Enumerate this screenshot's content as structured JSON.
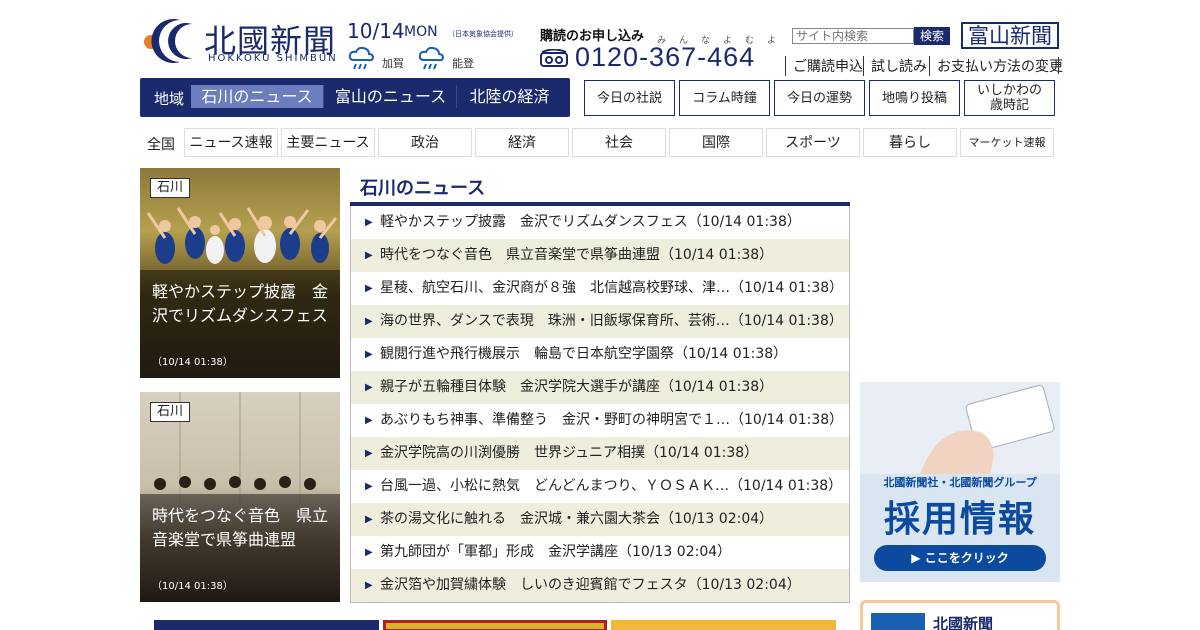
{
  "header": {
    "logo_jp": "北國新聞",
    "logo_en": "HOKKOKU SHIMBUN",
    "date": "10/14",
    "weekday": "MON",
    "weather_source": "（日本気象協会提供）",
    "weather": [
      {
        "area": "加賀",
        "icon": "rain-cloud-icon"
      },
      {
        "area": "能登",
        "icon": "rain-cloud-icon"
      }
    ],
    "subscribe_label": "購読のお申し込み",
    "phone_ruby": "みんなよむよ",
    "phone": "0120-367-464",
    "search_placeholder": "サイト内検索",
    "search_button": "検索",
    "toyama_link": "富山新聞",
    "links": [
      "ご購読申込",
      "試し読み",
      "お支払い方法の変更"
    ]
  },
  "region_nav": {
    "label": "地域",
    "tabs": [
      "石川のニュース",
      "富山のニュース",
      "北陸の経済"
    ],
    "active": "石川のニュース"
  },
  "feature_buttons": [
    "今日の社説",
    "コラム時鐘",
    "今日の運勢",
    "地鳴り投稿",
    "いしかわの\n歳時記"
  ],
  "category_nav": {
    "label": "全国",
    "items": [
      "ニュース速報",
      "主要ニュース",
      "政治",
      "経済",
      "社会",
      "国際",
      "スポーツ",
      "暮らし",
      "マーケット速報"
    ]
  },
  "photo_cards": [
    {
      "badge": "石川",
      "title": "軽やかステップ披露　金沢でリズムダンスフェス",
      "time": "（10/14 01:38）"
    },
    {
      "badge": "石川",
      "title": "時代をつなぐ音色　県立音楽堂で県筝曲連盟",
      "time": "（10/14 01:38）"
    }
  ],
  "news": {
    "title": "石川のニュース",
    "items": [
      "軽やかステップ披露　金沢でリズムダンスフェス（10/14 01:38）",
      "時代をつなぐ音色　県立音楽堂で県筝曲連盟（10/14 01:38）",
      "星稜、航空石川、金沢商が８強　北信越高校野球、津…（10/14 01:38）",
      "海の世界、ダンスで表現　珠洲・旧飯塚保育所、芸術…（10/14 01:38）",
      "観閲行進や飛行機展示　輪島で日本航空学園祭（10/14 01:38）",
      "親子が五輪種目体験　金沢学院大選手が講座（10/14 01:38）",
      "あぶりもち神事、準備整う　金沢・野町の神明宮で１…（10/14 01:38）",
      "金沢学院高の川渕優勝　世界ジュニア相撲（10/14 01:38）",
      "台風一過、小松に熱気　どんどんまつり、ＹＯＳＡＫ…（10/14 01:38）",
      "茶の湯文化に触れる　金沢城・兼六園大茶会（10/13 02:04）",
      "第九師団が「軍都」形成　金沢学講座（10/13 02:04）",
      "金沢箔や加賀繍体験　しいのき迎賓館でフェスタ（10/13 02:04）"
    ]
  },
  "sidebar": {
    "ad_heading": "北國新聞社・北國新聞グループ",
    "ad_title": "採用情報",
    "ad_cta": "▶ ここをクリック",
    "card_title": "北國新聞"
  },
  "colors": {
    "brand": "#1a2a6c",
    "active_tab": "#6d7ec0",
    "row_alt": "#efeedd",
    "ad_blue": "#0b4a9e"
  }
}
